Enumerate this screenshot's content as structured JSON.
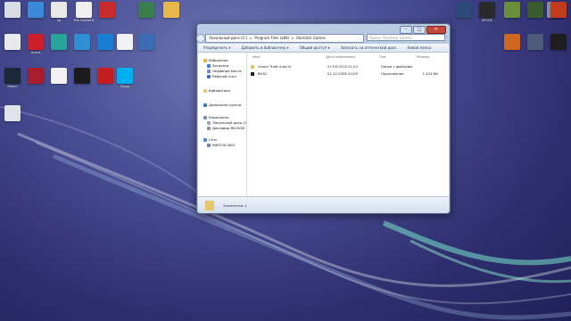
{
  "desktop_left": [
    {
      "label": "",
      "color": "#d9dde6"
    },
    {
      "label": "",
      "color": "#3b8ad8"
    },
    {
      "label": "hq",
      "color": "#e8e8e8"
    },
    {
      "label": "MSI BANNER",
      "color": "#f0f0f0"
    },
    {
      "label": "",
      "color": "#c92a2a"
    },
    {
      "label": "",
      "color": "#3a7d4f"
    },
    {
      "label": "",
      "color": "#e6b84a"
    },
    {
      "label": "",
      "color": "#e8eaee"
    },
    {
      "label": "Opera",
      "color": "#cc1f2d"
    },
    {
      "label": "",
      "color": "#2aa39a"
    },
    {
      "label": "",
      "color": "#2f8fd2"
    },
    {
      "label": "",
      "color": "#1a7fd4"
    },
    {
      "label": "",
      "color": "#f2f2f2"
    },
    {
      "label": "",
      "color": "#3c6cb4"
    },
    {
      "label": "Steam",
      "color": "#1b2838"
    },
    {
      "label": "",
      "color": "#a81d2b"
    },
    {
      "label": "",
      "color": "#f1f1f1"
    },
    {
      "label": "",
      "color": "#1c1c1c"
    },
    {
      "label": "",
      "color": "#c41e1e"
    },
    {
      "label": "Skype",
      "color": "#00aff0"
    },
    {
      "label": "",
      "color": "#dfe3ea"
    }
  ],
  "desktop_right": [
    {
      "label": "",
      "color": "#2b4a7a"
    },
    {
      "label": "SPORE",
      "color": "#2a2a2a"
    },
    {
      "label": "",
      "color": "#6b8e3a"
    },
    {
      "label": "",
      "color": "#3b5b2e"
    },
    {
      "label": "",
      "color": "#8a9098"
    },
    {
      "label": "",
      "color": "#d0671f"
    },
    {
      "label": "",
      "color": "#4d5a78"
    },
    {
      "label": "",
      "color": "#1e1e1e"
    },
    {
      "label": "",
      "color": "#c23b1d"
    }
  ],
  "window": {
    "address_segments": [
      "Локальный диск (C:)",
      "Program Files (x86)",
      "Rockstar Games"
    ],
    "search_placeholder": "Поиск: Rockstar Games",
    "toolbar": [
      "Упорядочить ▾",
      "Добавить в библиотеку ▾",
      "Общий доступ ▾",
      "Записать на оптический диск",
      "Новая папка"
    ],
    "nav_items": [
      {
        "label": "Избранное",
        "color": "#e7b53b"
      },
      {
        "label": "Загрузки",
        "color": "#3a7fd0"
      },
      {
        "label": "Недавние места",
        "color": "#6b8cc4"
      },
      {
        "label": "Рабочий стол",
        "color": "#3a6fb8"
      },
      {
        "label": "Библиотеки",
        "color": "#e7c56a"
      },
      {
        "label": "Домашняя группа",
        "color": "#2f7fcf"
      },
      {
        "label": "Компьютер",
        "color": "#7c8fae"
      },
      {
        "label": "Локальный диск (C:)",
        "color": "#9aa6ba"
      },
      {
        "label": "Дисковод BD-ROM",
        "color": "#8b96a8"
      },
      {
        "label": "Сеть",
        "color": "#4a8ad0"
      },
      {
        "label": "NIKITOS-VAIO",
        "color": "#6c84aa"
      }
    ],
    "columns": [
      "Имя",
      "Дата изменения",
      "Тип",
      "Размер"
    ],
    "rows": [
      {
        "name": "Grand Theft Auto IV",
        "date": "27.09.2014 21:23",
        "type": "Папка с файлами",
        "size": "",
        "color": "#e7c56a"
      },
      {
        "name": "BGSC",
        "date": "01.12.2008 20:09",
        "type": "Приложение",
        "size": "1 424 КБ",
        "color": "#1f1f1f"
      }
    ],
    "status_text": "Элементов: 2"
  }
}
